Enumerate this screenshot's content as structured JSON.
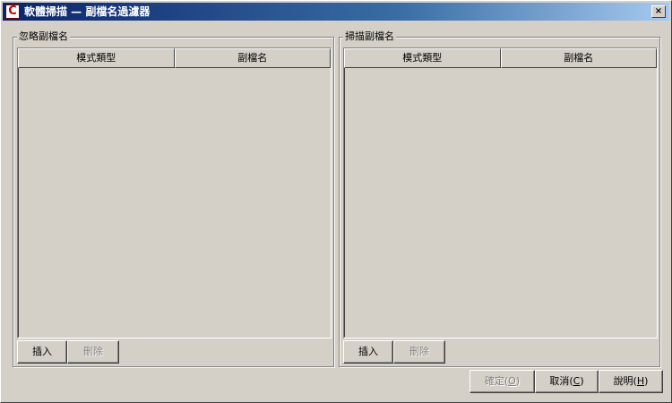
{
  "window": {
    "title": "軟體掃描 — 副檔名過濾器",
    "close_glyph": "×",
    "app_icon_glyph": "C"
  },
  "ignore_group": {
    "legend": "忽略副檔名",
    "columns": [
      "模式類型",
      "副檔名"
    ],
    "rows": [],
    "insert_label": "插入",
    "delete_label": "刪除"
  },
  "scan_group": {
    "legend": "掃描副檔名",
    "columns": [
      "模式類型",
      "副檔名"
    ],
    "rows": [],
    "insert_label": "插入",
    "delete_label": "刪除"
  },
  "footer": {
    "ok_label": "確定(",
    "ok_key": "O",
    "cancel_label": "取消(",
    "cancel_key": "C",
    "help_label": "說明(",
    "help_key": "H",
    "close_paren": ")"
  }
}
